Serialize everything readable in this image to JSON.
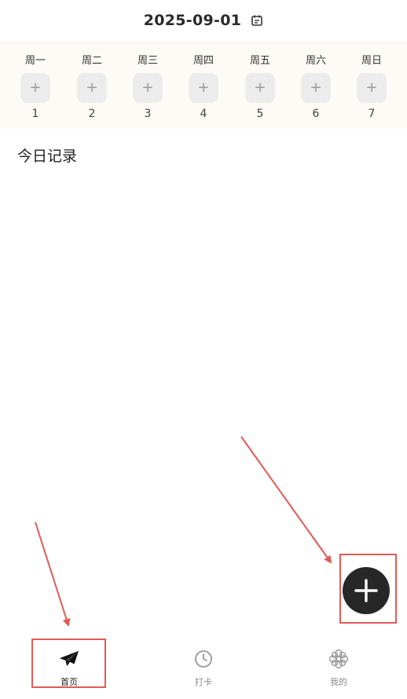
{
  "header": {
    "date": "2025-09-01",
    "calendar_icon": "calendar-icon"
  },
  "week": {
    "days": [
      {
        "label": "周一",
        "num": "1",
        "add": "+"
      },
      {
        "label": "周二",
        "num": "2",
        "add": "+"
      },
      {
        "label": "周三",
        "num": "3",
        "add": "+"
      },
      {
        "label": "周四",
        "num": "4",
        "add": "+"
      },
      {
        "label": "周五",
        "num": "5",
        "add": "+"
      },
      {
        "label": "周六",
        "num": "6",
        "add": "+"
      },
      {
        "label": "周日",
        "num": "7",
        "add": "+"
      }
    ]
  },
  "main": {
    "section_title": "今日记录"
  },
  "fab": {
    "icon": "plus-icon"
  },
  "tabbar": {
    "tabs": [
      {
        "label": "首页",
        "icon": "paper-plane-icon",
        "active": true
      },
      {
        "label": "打卡",
        "icon": "clock-icon",
        "active": false
      },
      {
        "label": "我的",
        "icon": "flower-icon",
        "active": false
      }
    ]
  },
  "colors": {
    "background": "#ffffff",
    "week_strip": "#fcfbf6",
    "day_button": "#ececec",
    "fab": "#272727",
    "highlight": "#e05a56"
  }
}
